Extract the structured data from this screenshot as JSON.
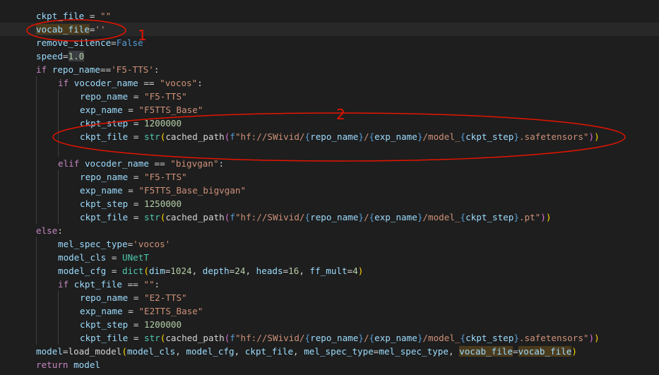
{
  "annotations": {
    "label_1": "1",
    "label_2": "2",
    "color": "#e51400"
  },
  "lines": [
    [
      [
        "var",
        "ckpt_file"
      ],
      [
        "op",
        " = "
      ],
      [
        "str",
        "\"\""
      ]
    ],
    [
      [
        "var hl-word",
        "vocab_file"
      ],
      [
        "op",
        "="
      ],
      [
        "str",
        "''"
      ]
    ],
    [
      [
        "var",
        "remove_silence"
      ],
      [
        "op",
        "="
      ],
      [
        "kw",
        "False"
      ]
    ],
    [
      [
        "var",
        "speed"
      ],
      [
        "op",
        "="
      ],
      [
        "num hl-num",
        "1.0"
      ]
    ],
    [
      [
        "ctl",
        "if"
      ],
      [
        "op",
        " "
      ],
      [
        "var",
        "repo_name"
      ],
      [
        "op",
        "=="
      ],
      [
        "str",
        "'F5-TTS'"
      ],
      [
        "op",
        ":"
      ]
    ],
    [
      [
        "ctl",
        "if"
      ],
      [
        "op",
        " "
      ],
      [
        "var",
        "vocoder_name"
      ],
      [
        "op",
        " == "
      ],
      [
        "str",
        "\"vocos\""
      ],
      [
        "op",
        ":"
      ]
    ],
    [
      [
        "var",
        "repo_name"
      ],
      [
        "op",
        " = "
      ],
      [
        "str",
        "\"F5-TTS\""
      ]
    ],
    [
      [
        "var",
        "exp_name"
      ],
      [
        "op",
        " = "
      ],
      [
        "str",
        "\"F5TTS_Base\""
      ]
    ],
    [
      [
        "var",
        "ckpt_step"
      ],
      [
        "op",
        " = "
      ],
      [
        "num",
        "1200000"
      ]
    ],
    [
      [
        "var",
        "ckpt_file"
      ],
      [
        "op",
        " = "
      ],
      [
        "fn",
        "str"
      ],
      [
        "brk1",
        "("
      ],
      [
        "op",
        "cached_path"
      ],
      [
        "brk2",
        "("
      ],
      [
        "fstrf",
        "f"
      ],
      [
        "str",
        "\"hf://SWivid/"
      ],
      [
        "kw",
        "{"
      ],
      [
        "var",
        "repo_name"
      ],
      [
        "kw",
        "}"
      ],
      [
        "str",
        "/"
      ],
      [
        "kw",
        "{"
      ],
      [
        "var",
        "exp_name"
      ],
      [
        "kw",
        "}"
      ],
      [
        "str",
        "/model_"
      ],
      [
        "kw",
        "{"
      ],
      [
        "var",
        "ckpt_step"
      ],
      [
        "kw",
        "}"
      ],
      [
        "str",
        ".safetensors\""
      ],
      [
        "brk2",
        ")"
      ],
      [
        "brk1",
        ")"
      ]
    ],
    [],
    [
      [
        "ctl",
        "elif"
      ],
      [
        "op",
        " "
      ],
      [
        "var",
        "vocoder_name"
      ],
      [
        "op",
        " == "
      ],
      [
        "str",
        "\"bigvgan\""
      ],
      [
        "op",
        ":"
      ]
    ],
    [
      [
        "var",
        "repo_name"
      ],
      [
        "op",
        " = "
      ],
      [
        "str",
        "\"F5-TTS\""
      ]
    ],
    [
      [
        "var",
        "exp_name"
      ],
      [
        "op",
        " = "
      ],
      [
        "str",
        "\"F5TTS_Base_bigvgan\""
      ]
    ],
    [
      [
        "var",
        "ckpt_step"
      ],
      [
        "op",
        " = "
      ],
      [
        "num",
        "1250000"
      ]
    ],
    [
      [
        "var",
        "ckpt_file"
      ],
      [
        "op",
        " = "
      ],
      [
        "fn",
        "str"
      ],
      [
        "brk1",
        "("
      ],
      [
        "op",
        "cached_path"
      ],
      [
        "brk2",
        "("
      ],
      [
        "fstrf",
        "f"
      ],
      [
        "str",
        "\"hf://SWivid/"
      ],
      [
        "kw",
        "{"
      ],
      [
        "var",
        "repo_name"
      ],
      [
        "kw",
        "}"
      ],
      [
        "str",
        "/"
      ],
      [
        "kw",
        "{"
      ],
      [
        "var",
        "exp_name"
      ],
      [
        "kw",
        "}"
      ],
      [
        "str",
        "/model_"
      ],
      [
        "kw",
        "{"
      ],
      [
        "var",
        "ckpt_step"
      ],
      [
        "kw",
        "}"
      ],
      [
        "str",
        ".pt\""
      ],
      [
        "brk2",
        ")"
      ],
      [
        "brk1",
        ")"
      ]
    ],
    [
      [
        "ctl",
        "else"
      ],
      [
        "op",
        ":"
      ]
    ],
    [
      [
        "var",
        "mel_spec_type"
      ],
      [
        "op",
        "="
      ],
      [
        "str",
        "'vocos'"
      ]
    ],
    [
      [
        "var",
        "model_cls"
      ],
      [
        "op",
        " = "
      ],
      [
        "fn",
        "UNetT"
      ]
    ],
    [
      [
        "var",
        "model_cfg"
      ],
      [
        "op",
        " = "
      ],
      [
        "fn",
        "dict"
      ],
      [
        "brk1",
        "("
      ],
      [
        "var",
        "dim"
      ],
      [
        "op",
        "="
      ],
      [
        "num",
        "1024"
      ],
      [
        "op",
        ", "
      ],
      [
        "var",
        "depth"
      ],
      [
        "op",
        "="
      ],
      [
        "num",
        "24"
      ],
      [
        "op",
        ", "
      ],
      [
        "var",
        "heads"
      ],
      [
        "op",
        "="
      ],
      [
        "num",
        "16"
      ],
      [
        "op",
        ", "
      ],
      [
        "var",
        "ff_mult"
      ],
      [
        "op",
        "="
      ],
      [
        "num",
        "4"
      ],
      [
        "brk1",
        ")"
      ]
    ],
    [
      [
        "ctl",
        "if"
      ],
      [
        "op",
        " "
      ],
      [
        "var",
        "ckpt_file"
      ],
      [
        "op",
        " == "
      ],
      [
        "str",
        "\"\""
      ],
      [
        "op",
        ":"
      ]
    ],
    [
      [
        "var",
        "repo_name"
      ],
      [
        "op",
        " = "
      ],
      [
        "str",
        "\"E2-TTS\""
      ]
    ],
    [
      [
        "var",
        "exp_name"
      ],
      [
        "op",
        " = "
      ],
      [
        "str",
        "\"E2TTS_Base\""
      ]
    ],
    [
      [
        "var",
        "ckpt_step"
      ],
      [
        "op",
        " = "
      ],
      [
        "num",
        "1200000"
      ]
    ],
    [
      [
        "var",
        "ckpt_file"
      ],
      [
        "op",
        " = "
      ],
      [
        "fn",
        "str"
      ],
      [
        "brk1",
        "("
      ],
      [
        "op",
        "cached_path"
      ],
      [
        "brk2",
        "("
      ],
      [
        "fstrf",
        "f"
      ],
      [
        "str",
        "\"hf://SWivid/"
      ],
      [
        "kw",
        "{"
      ],
      [
        "var",
        "repo_name"
      ],
      [
        "kw",
        "}"
      ],
      [
        "str",
        "/"
      ],
      [
        "kw",
        "{"
      ],
      [
        "var",
        "exp_name"
      ],
      [
        "kw",
        "}"
      ],
      [
        "str",
        "/model_"
      ],
      [
        "kw",
        "{"
      ],
      [
        "var",
        "ckpt_step"
      ],
      [
        "kw",
        "}"
      ],
      [
        "str",
        ".safetensors\""
      ],
      [
        "brk2",
        ")"
      ],
      [
        "brk1",
        ")"
      ]
    ],
    [
      [
        "var",
        "model"
      ],
      [
        "op",
        "="
      ],
      [
        "op",
        "load_model"
      ],
      [
        "brk1",
        "("
      ],
      [
        "var",
        "model_cls"
      ],
      [
        "op",
        ", "
      ],
      [
        "var",
        "model_cfg"
      ],
      [
        "op",
        ", "
      ],
      [
        "var",
        "ckpt_file"
      ],
      [
        "op",
        ", "
      ],
      [
        "var",
        "mel_spec_type"
      ],
      [
        "op",
        "="
      ],
      [
        "var",
        "mel_spec_type"
      ],
      [
        "op",
        ", "
      ],
      [
        "var hl-word",
        "vocab_file"
      ],
      [
        "op",
        "="
      ],
      [
        "var hl-word",
        "vocab_file"
      ],
      [
        "brk1",
        ")"
      ]
    ],
    [
      [
        "ctl",
        "return"
      ],
      [
        "op",
        " "
      ],
      [
        "var",
        "model"
      ]
    ]
  ]
}
